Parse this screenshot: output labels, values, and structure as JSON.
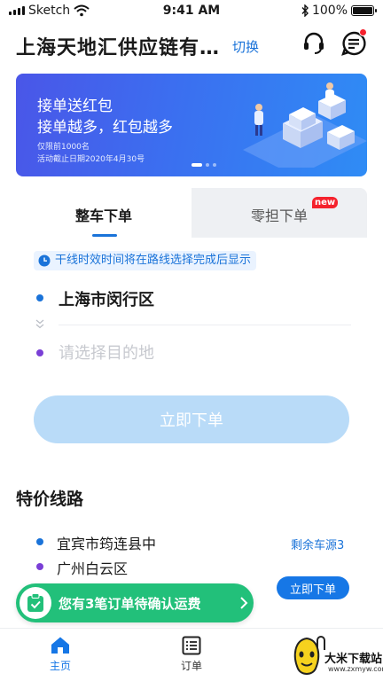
{
  "status_bar": {
    "carrier": "Sketch",
    "time": "9:41 AM",
    "battery": "100%"
  },
  "header": {
    "company_name": "上海天地汇供应链有…",
    "switch_label": "切换",
    "headset_icon": "headset-icon",
    "message_icon": "message-icon",
    "has_unread": true
  },
  "banner": {
    "title": "接单送红包",
    "subtitle": "接单越多，红包越多",
    "note_1": "仅限前1000名",
    "note_2": "活动截止日期2020年4月30号",
    "page_count": 3,
    "active_page": 1
  },
  "order": {
    "tabs": [
      {
        "label": "整车下单",
        "active": true
      },
      {
        "label": "零担下单",
        "active": false,
        "badge": "new"
      }
    ],
    "notice": "干线时效时间将在路线选择完成后显示",
    "origin": "上海市闵行区",
    "destination_placeholder": "请选择目的地",
    "submit_label": "立即下单"
  },
  "special_routes": {
    "title": "特价线路",
    "items": [
      {
        "from": "宜宾市筠连县中",
        "to": "广州白云区",
        "seats": "剩余车源3",
        "action": "立即下单"
      }
    ]
  },
  "toast": {
    "text": "您有3笔订单待确认运费"
  },
  "tabbar": {
    "items": [
      {
        "label": "主页",
        "icon": "home-icon",
        "active": true
      },
      {
        "label": "订单",
        "icon": "orders-icon",
        "active": false
      },
      {
        "label": "",
        "icon": "mine-icon",
        "active": false
      }
    ]
  },
  "watermark": {
    "title": "大米下载站",
    "url": "www.zxmyw.com"
  },
  "colors": {
    "primary": "#1677e6",
    "accent_green": "#22c07a",
    "badge_red": "#f5222d",
    "destination_dot": "#7a3fd6"
  }
}
